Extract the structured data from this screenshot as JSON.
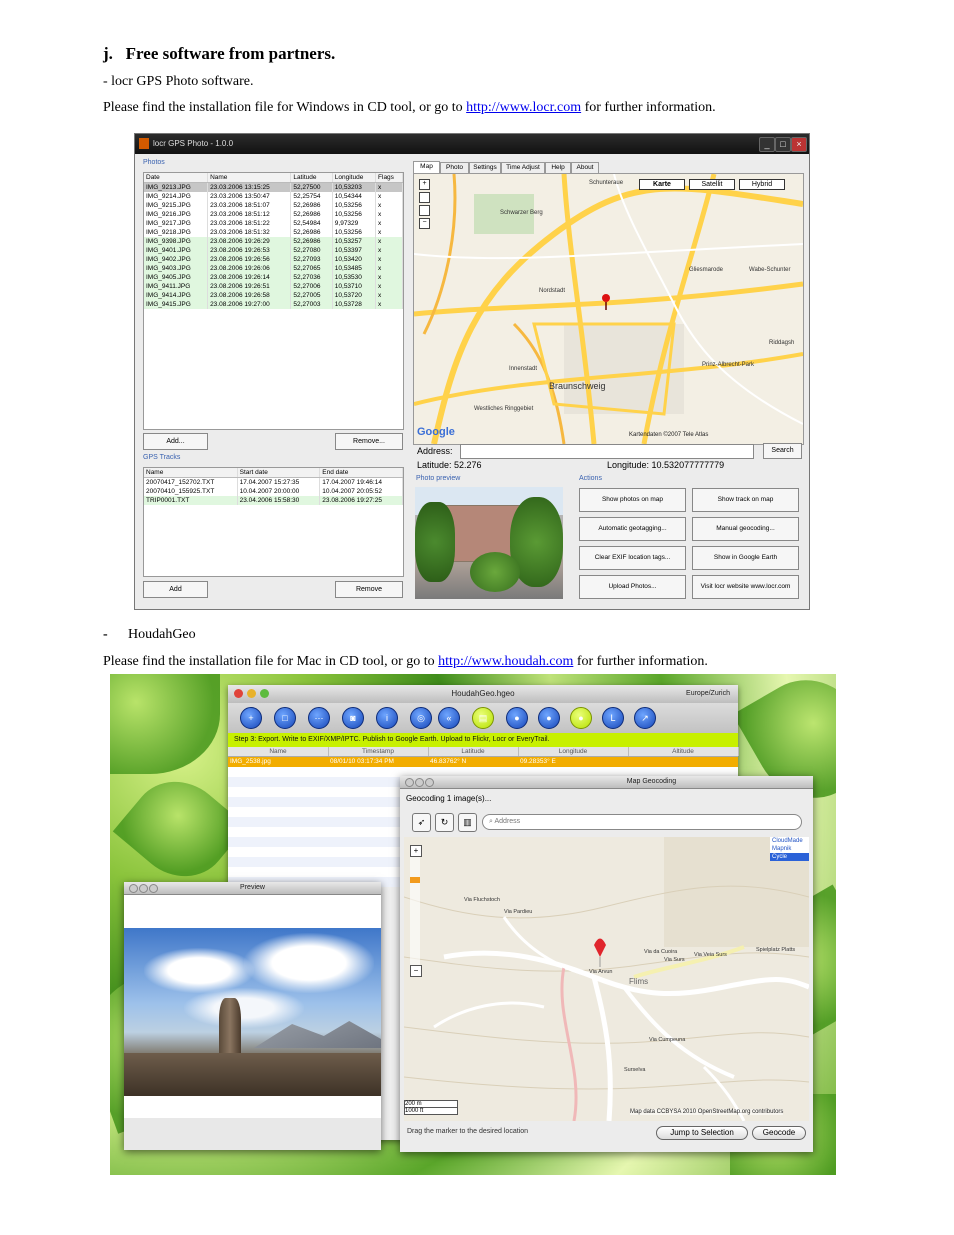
{
  "section": {
    "heading": "j.   Free software from partners.",
    "locr_item": "- locr GPS Photo software.",
    "locr_text_before": "Please find the installation file for Windows in CD tool, or go to ",
    "locr_link": "http://www.locr.com",
    "locr_text_after": " for further information.",
    "houdah_bullet": "-",
    "houdah_item": "HoudahGeo",
    "houdah_text_before": "Please find the installation file for Mac in CD tool, or go to ",
    "houdah_link": "http://www.houdah.com",
    "houdah_text_after": " for further information."
  },
  "locr": {
    "title": "locr GPS Photo - 1.0.0",
    "photos_label": "Photos",
    "photo_columns": [
      "Date",
      "Name",
      "Latitude",
      "Longitude",
      "Flags"
    ],
    "photos": [
      [
        "IMG_9213.JPG",
        "23.03.2006 13:15:25",
        "52,27500",
        "10,53203",
        "x"
      ],
      [
        "IMG_9214.JPG",
        "23.03.2006 13:50:47",
        "52,25754",
        "10,54344",
        "x"
      ],
      [
        "IMG_9215.JPG",
        "23.03.2006 18:51:07",
        "52,26986",
        "10,53256",
        "x"
      ],
      [
        "IMG_9216.JPG",
        "23.03.2006 18:51:12",
        "52,26986",
        "10,53256",
        "x"
      ],
      [
        "IMG_9217.JPG",
        "23.03.2006 18:51:22",
        "52,54984",
        "9,97329",
        "x"
      ],
      [
        "IMG_9218.JPG",
        "23.03.2006 18:51:32",
        "52,26986",
        "10,53256",
        "x"
      ],
      [
        "IMG_9398.JPG",
        "23.08.2006 19:26:29",
        "52,26986",
        "10,53257",
        "x"
      ],
      [
        "IMG_9401.JPG",
        "23.08.2006 19:26:53",
        "52,27080",
        "10,53397",
        "x"
      ],
      [
        "IMG_9402.JPG",
        "23.08.2006 19:26:56",
        "52,27093",
        "10,53420",
        "x"
      ],
      [
        "IMG_9403.JPG",
        "23.08.2006 19:26:06",
        "52,27065",
        "10,53485",
        "x"
      ],
      [
        "IMG_9405.JPG",
        "23.08.2006 19:26:14",
        "52,27036",
        "10,53530",
        "x"
      ],
      [
        "IMG_9411.JPG",
        "23.08.2006 19:26:51",
        "52,27006",
        "10,53710",
        "x"
      ],
      [
        "IMG_9414.JPG",
        "23.08.2006 19:26:58",
        "52,27005",
        "10,53720",
        "x"
      ],
      [
        "IMG_9415.JPG",
        "23.08.2006 19:27:00",
        "52,27003",
        "10,53728",
        "x"
      ]
    ],
    "add_button": "Add...",
    "remove_button": "Remove...",
    "tracks_label": "GPS Tracks",
    "track_columns": [
      "Name",
      "Start date",
      "End date"
    ],
    "tracks": [
      [
        "20070417_152702.TXT",
        "17.04.2007 15:27:35",
        "17.04.2007 19:46:14"
      ],
      [
        "20070410_155925.TXT",
        "10.04.2007 20:00:00",
        "10.04.2007 20:05:52"
      ],
      [
        "TRIP0001.TXT",
        "23.04.2006 15:58:30",
        "23.08.2006 19:27:25"
      ]
    ],
    "tracks_add": "Add",
    "tracks_remove": "Remove",
    "tabs": [
      "Map",
      "Photo",
      "Settings",
      "Time Adjust",
      "Help",
      "About"
    ],
    "map_types": [
      "Karte",
      "Satellit",
      "Hybrid"
    ],
    "map_labels": [
      "Schunteraue",
      "Schwarzer Berg",
      "Gliesmarode",
      "Wabe-Schunter",
      "Nordstadt",
      "Innenstadt",
      "Braunschweig",
      "Prinz-Albrecht-Park",
      "Westliches Ringgebiet",
      "Riddagsh"
    ],
    "map_copyright": "Kartendaten ©2007 Tele Atlas",
    "address_label": "Address:",
    "search_button": "Search",
    "latitude": "Latitude: 52.276",
    "longitude": "Longitude: 10.532077777779",
    "preview_label": "Photo preview",
    "actions_label": "Actions",
    "actions": [
      "Show photos on map",
      "Show track on map",
      "Automatic geotagging...",
      "Manual geocoding...",
      "Clear EXIF location tags...",
      "Show in Google Earth",
      "Upload Photos...",
      "Visit locr website www.locr.com"
    ],
    "google_logo": "Google"
  },
  "houdah": {
    "title": "HoudahGeo.hgeo",
    "timezone": "Europe/Zurich",
    "step": "Step 3: Export. Write to EXIF/XMP/IPTC. Publish to Google Earth. Upload to Flickr, Locr or EveryTrail.",
    "columns": [
      "Name",
      "Timestamp",
      "Latitude",
      "Longitude",
      "Altitude"
    ],
    "row": [
      "IMG_2538.jpg",
      "08/01/10 03:17:34 PM",
      "46.83762° N",
      "09.28353° E",
      ""
    ],
    "map_window_title": "Map Geocoding",
    "geocoding_text": "Geocoding 1 image(s)...",
    "address_placeholder": "Address",
    "map_providers": [
      "CloudMade",
      "Mapnik",
      "Cycle"
    ],
    "map_labels": [
      "Via Fluchstoch",
      "Via Pardieu",
      "Via da Cuoira",
      "Via Surs",
      "Via Veia Surs",
      "Spielplatz Platts",
      "Flims",
      "Via Arvun",
      "Via Cumpeuna",
      "Surselva"
    ],
    "scale_m": "200 m",
    "scale_ft": "1000 ft",
    "attribution": "Map data CCBYSA 2010 OpenStreetMap.org contributors",
    "hint": "Drag the marker to the desired location",
    "jump_button": "Jump to Selection",
    "geocode_button": "Geocode",
    "preview_title": "Preview"
  }
}
